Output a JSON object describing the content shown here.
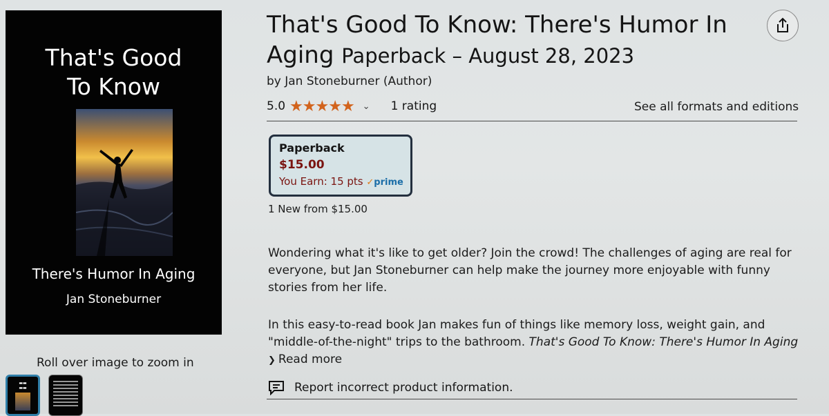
{
  "cover": {
    "title_line1": "That's Good",
    "title_line2": "To Know",
    "subtitle": "There's Humor In Aging",
    "author": "Jan Stoneburner"
  },
  "gallery": {
    "zoom_hint": "Roll over image to zoom in",
    "thumbnails": [
      "cover-thumbnail",
      "back-cover-thumbnail"
    ]
  },
  "product": {
    "title": "That's Good To Know: There's Humor In Aging",
    "binding_date": "Paperback – August 28, 2023",
    "byline": "by Jan Stoneburner (Author)",
    "rating_value": "5.0",
    "stars": "★★★★★",
    "rating_count": "1 rating",
    "formats_link": "See all formats and editions"
  },
  "format_card": {
    "name": "Paperback",
    "price": "$15.00",
    "earn": "You Earn: 15 pts",
    "prime_label": "prime",
    "new_from": "1 New from $15.00"
  },
  "description": {
    "p1": "Wondering what it's like to get older? Join the crowd! The challenges of aging are real for everyone, but Jan Stoneburner can help make the journey more enjoyable with funny stories from her life.",
    "p2_text": "In this easy-to-read book Jan makes fun of things like memory loss, weight gain, and \"middle-of-the-night\" trips to the bathroom. ",
    "p2_italic": "That's Good To Know: There's Humor In Aging",
    "read_more": "Read more"
  },
  "report": {
    "label": "Report incorrect product information."
  },
  "colors": {
    "star": "#d2631c",
    "price": "#7a1410",
    "prime": "#1b6ea8",
    "card_border": "#232f3e"
  },
  "icons": [
    "share-icon",
    "star-icon",
    "chevron-down-icon",
    "report-icon"
  ]
}
